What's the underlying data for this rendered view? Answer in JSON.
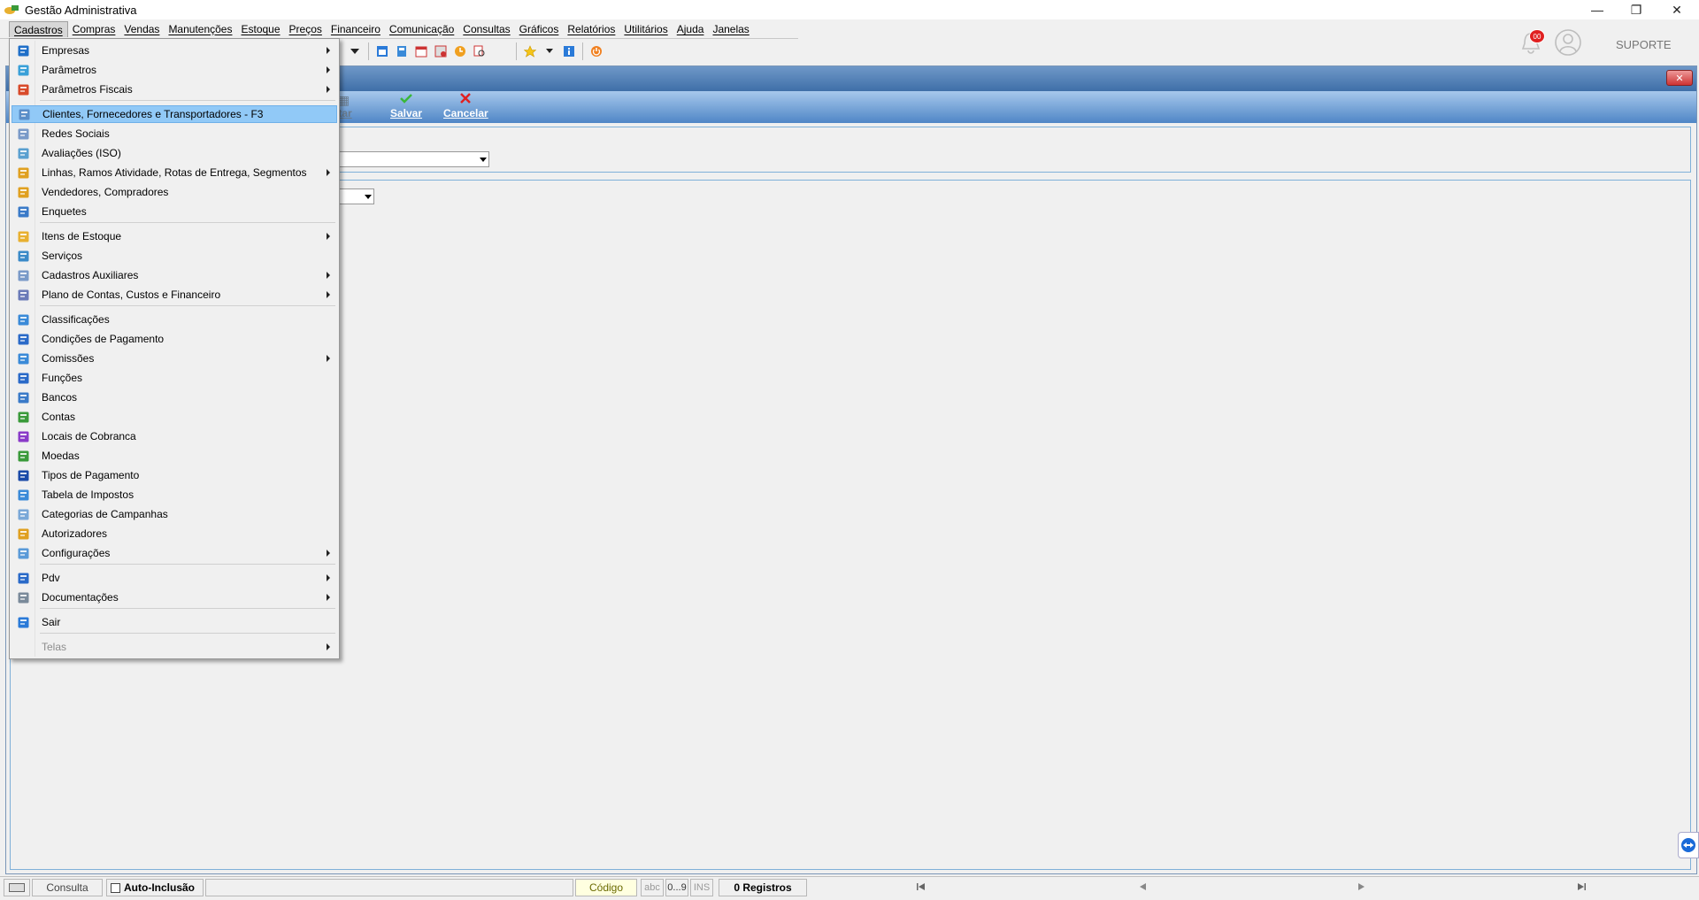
{
  "window": {
    "title": "Gestão Administrativa"
  },
  "menubar": [
    "Cadastros",
    "Compras",
    "Vendas",
    "Manutenções",
    "Estoque",
    "Preços",
    "Financeiro",
    "Comunicação",
    "Consultas",
    "Gráficos",
    "Relatórios",
    "Utilitários",
    "Ajuda",
    "Janelas"
  ],
  "user": {
    "notifications": "00",
    "name": "SUPORTE"
  },
  "ribbon": {
    "partial": "itar",
    "save": "Salvar",
    "cancel": "Cancelar"
  },
  "dropdown": {
    "items": [
      {
        "label": "Empresas",
        "icon": "building-icon",
        "color": "#1f6fc8",
        "submenu": true
      },
      {
        "label": "Parâmetros",
        "icon": "grid-icon",
        "color": "#3aa0d8",
        "submenu": true
      },
      {
        "label": "Parâmetros Fiscais",
        "icon": "fiscal-icon",
        "color": "#d84a2a",
        "submenu": true
      },
      {
        "label": "Clientes, Fornecedores e Transportadores - F3",
        "icon": "clients-icon",
        "color": "#5a8ec8",
        "submenu": false,
        "highlight": true
      },
      {
        "label": "Redes Sociais",
        "icon": "network-icon",
        "color": "#7a9ac8",
        "submenu": false
      },
      {
        "label": "Avaliações (ISO)",
        "icon": "evaluation-icon",
        "color": "#5aa0d0",
        "submenu": false
      },
      {
        "label": "Linhas, Ramos Atividade, Rotas de Entrega, Segmentos",
        "icon": "tree-icon",
        "color": "#e0a020",
        "submenu": true
      },
      {
        "label": "Vendedores, Compradores",
        "icon": "person-icon",
        "color": "#e0a020",
        "submenu": false
      },
      {
        "label": "Enquetes",
        "icon": "list-icon",
        "color": "#3a7ac8",
        "submenu": false
      },
      {
        "label": "Itens de Estoque",
        "icon": "box-icon",
        "color": "#e8b030",
        "submenu": true
      },
      {
        "label": "Serviços",
        "icon": "service-icon",
        "color": "#3a8ac8",
        "submenu": false
      },
      {
        "label": "Cadastros Auxiliares",
        "icon": "auxiliary-icon",
        "color": "#7a9ac8",
        "submenu": true
      },
      {
        "label": "Plano de Contas, Custos e Financeiro",
        "icon": "ledger-icon",
        "color": "#6a7ab8",
        "submenu": true
      },
      {
        "label": "Classificações",
        "icon": "classification-icon",
        "color": "#3a8ad8",
        "submenu": false
      },
      {
        "label": "Condições de Pagamento",
        "icon": "payment-icon",
        "color": "#2a6ac8",
        "submenu": false
      },
      {
        "label": "Comissões",
        "icon": "commission-icon",
        "color": "#3a8ad8",
        "submenu": true
      },
      {
        "label": "Funções",
        "icon": "function-icon",
        "color": "#2a6ac8",
        "submenu": false
      },
      {
        "label": "Bancos",
        "icon": "bank-icon",
        "color": "#3a7ac8",
        "submenu": false
      },
      {
        "label": "Contas",
        "icon": "accounts-icon",
        "color": "#3a9a3a",
        "submenu": false
      },
      {
        "label": "Locais de Cobranca",
        "icon": "locations-icon",
        "color": "#8a3ac8",
        "submenu": false
      },
      {
        "label": "Moedas",
        "icon": "coins-icon",
        "color": "#3a9a3a",
        "submenu": false
      },
      {
        "label": "Tipos de Pagamento",
        "icon": "visa-icon",
        "color": "#1a4aa8",
        "submenu": false
      },
      {
        "label": "Tabela de Impostos",
        "icon": "tax-table-icon",
        "color": "#3a8ad8",
        "submenu": false
      },
      {
        "label": "Categorias de Campanhas",
        "icon": "category-icon",
        "color": "#7aa8d8",
        "submenu": false
      },
      {
        "label": "Autorizadores",
        "icon": "authorizer-icon",
        "color": "#e0a020",
        "submenu": false
      },
      {
        "label": "Configurações",
        "icon": "config-icon",
        "color": "#5a9ad8",
        "submenu": true
      },
      {
        "label": "Pdv",
        "icon": "monitor-icon",
        "color": "#2a6ac8",
        "submenu": true
      },
      {
        "label": "Documentações",
        "icon": "document-icon",
        "color": "#7a8a9a",
        "submenu": true
      },
      {
        "label": "Sair",
        "icon": "exit-icon",
        "color": "#2a7ad8",
        "submenu": false
      },
      {
        "label": "Telas",
        "icon": "",
        "color": "",
        "submenu": true,
        "disabled": true
      }
    ]
  },
  "statusbar": {
    "mode": "Consulta",
    "auto_inclusion": "Auto-Inclusão",
    "code": "Código",
    "abc": "abc",
    "range": "0...9",
    "ins": "INS",
    "records": "0 Registros"
  }
}
